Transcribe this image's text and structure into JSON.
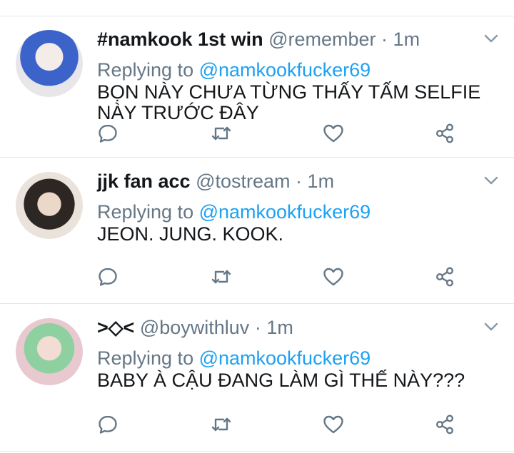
{
  "tweets": [
    {
      "name": "#namkook 1st win",
      "handle": "@remember",
      "dot": " · ",
      "time": "1m",
      "replying_prefix": "Replying to ",
      "reply_to": "@namkookfucker69",
      "text": "BỌN NÀY CHƯA TỪNG THẤY TẤM SELFIE NÀY TRƯỚC ĐÂY"
    },
    {
      "name": "jjk fan acc",
      "handle": "@tostream",
      "dot": " · ",
      "time": "1m",
      "replying_prefix": "Replying to ",
      "reply_to": "@namkookfucker69",
      "text": "JEON. JUNG. KOOK."
    },
    {
      "name": ">◇<",
      "handle": "@boywithluv",
      "dot": " · ",
      "time": "1m",
      "replying_prefix": "Replying to ",
      "reply_to": "@namkookfucker69",
      "text": "BABY À CẬU ĐANG LÀM GÌ THẾ NÀY???"
    }
  ],
  "icons": {
    "reply": "reply-bubble-icon",
    "retweet": "retweet-icon",
    "like": "heart-icon",
    "share": "share-icon",
    "more": "chevron-down-icon"
  },
  "colors": {
    "name": "#14171a",
    "secondary": "#657786",
    "mention": "#1da1f2",
    "divider": "#e1e8ed"
  }
}
